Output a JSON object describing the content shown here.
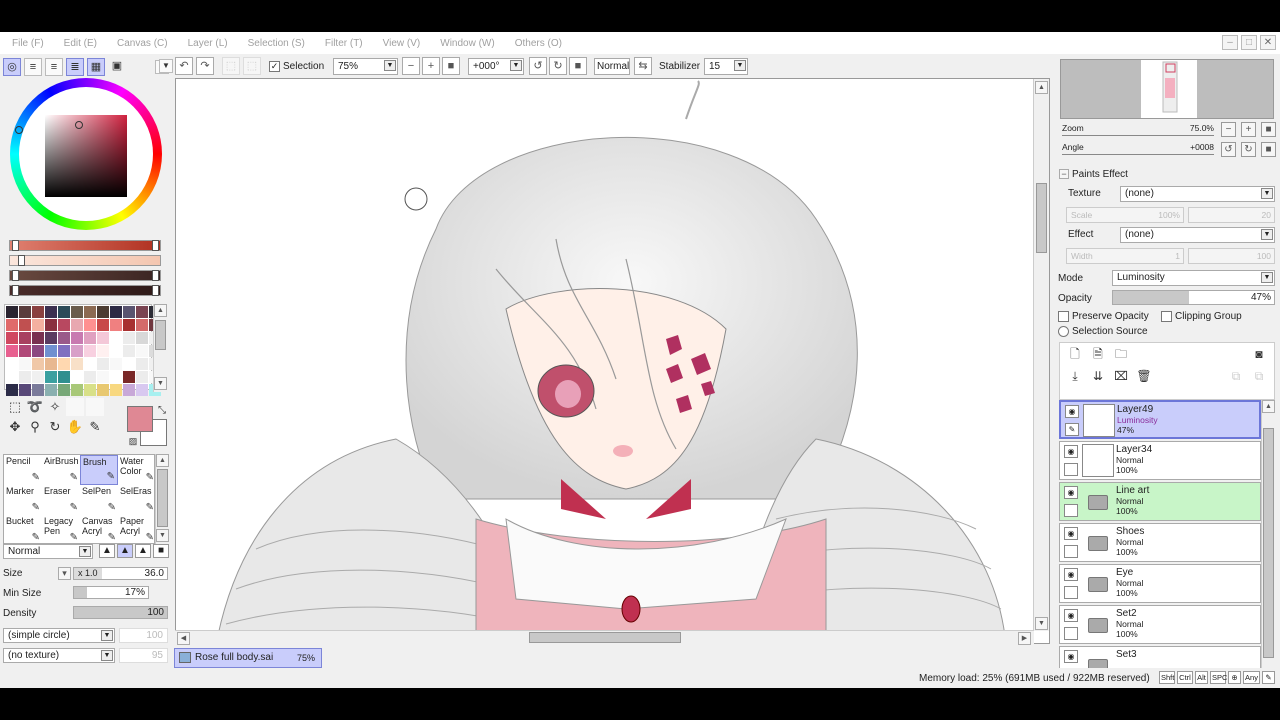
{
  "menu": [
    "File (F)",
    "Edit (E)",
    "Canvas (C)",
    "Layer (L)",
    "Selection (S)",
    "Filter (T)",
    "View (V)",
    "Window (W)",
    "Others (O)"
  ],
  "toolbar": {
    "selection_label": "Selection",
    "zoom": "75%",
    "angle": "+000°",
    "blend": "Normal",
    "stabilizer_label": "Stabilizer",
    "stabilizer_value": "15"
  },
  "color": {
    "primary": "#df8894",
    "secondary": "#ffffff"
  },
  "swatches": [
    "#2a2430",
    "#5a3c3c",
    "#8a4040",
    "#3c3050",
    "#2c4a58",
    "#6a5c4c",
    "#8c6a52",
    "#4c3c32",
    "#2e2a44",
    "#5a5470",
    "#7a4452",
    "#2c2c36",
    "#e06a6a",
    "#c05050",
    "#f4b0a0",
    "#8a3040",
    "#b84860",
    "#e8a8b0",
    "#ff9090",
    "#c84848",
    "#f08080",
    "#a83030",
    "#d46a6a",
    "#703840",
    "#d04860",
    "#a84060",
    "#7a3050",
    "#5a3a60",
    "#9a5a8a",
    "#c87ab0",
    "#e0a0c0",
    "#f4c8d8",
    "#ffffff",
    "#ececec",
    "#d8d8d8",
    "#f0f0f0",
    "#e86090",
    "#b04878",
    "#8c4880",
    "#7090d0",
    "#8070c0",
    "#d8a0c8",
    "#f8d0e0",
    "#fff0f0",
    "#ffffff",
    "#ececec",
    "#f8f8f8",
    "#dcdcdc",
    "#ffffff",
    "#f8f8f8",
    "#f0c8a8",
    "#e8b890",
    "#ffd8b0",
    "#f8e0c8",
    "#ffffff",
    "#ececec",
    "#f8f8f8",
    "#ffffff",
    "#ececec",
    "#f0f0f0",
    "#ffffff",
    "#ececec",
    "#f0f0f0",
    "#3aa0a0",
    "#2f8f8f",
    "#ffffff",
    "#ececec",
    "#f8f8f8",
    "#ffffff",
    "#7a2828",
    "#ececec",
    "#f8f8f8",
    "#2c2c48",
    "#584878",
    "#7a7a9a",
    "#8ab0b0",
    "#78a878",
    "#a8c878",
    "#d8e088",
    "#e8c870",
    "#f8d880",
    "#c8a8d8",
    "#d8c8f0",
    "#a8f0f0"
  ],
  "tools": {
    "brushes": [
      {
        "name": "Pencil",
        "line2": ""
      },
      {
        "name": "AirBrush",
        "line2": ""
      },
      {
        "name": "Brush",
        "line2": ""
      },
      {
        "name": "Water",
        "line2": "Color"
      },
      {
        "name": "Marker",
        "line2": ""
      },
      {
        "name": "Eraser",
        "line2": ""
      },
      {
        "name": "SelPen",
        "line2": ""
      },
      {
        "name": "SelEras",
        "line2": ""
      },
      {
        "name": "Bucket",
        "line2": ""
      },
      {
        "name": "Legacy",
        "line2": "Pen"
      },
      {
        "name": "Canvas",
        "line2": "Acryl"
      },
      {
        "name": "Paper",
        "line2": "Acryl"
      }
    ],
    "blend_mode": "Normal",
    "size_label": "Size",
    "size_mult": "x 1.0",
    "size_value": "36.0",
    "min_size_label": "Min Size",
    "min_size_value": "17%",
    "min_size_fraction": 0.17,
    "density_label": "Density",
    "density_value": "100",
    "density_fraction": 1.0,
    "shape": "(simple circle)",
    "shape_value": "100",
    "texture": "(no texture)",
    "texture_value": "95"
  },
  "navigator": {
    "zoom_label": "Zoom",
    "zoom_value": "75.0%",
    "angle_label": "Angle",
    "angle_value": "+0008"
  },
  "paints_effect": {
    "title": "Paints Effect",
    "texture_label": "Texture",
    "texture_value": "(none)",
    "scale_label": "Scale",
    "scale_value": "100%",
    "scale_num": "20",
    "effect_label": "Effect",
    "effect_value": "(none)",
    "width_label": "Width",
    "width_value": "1",
    "width_num": "100"
  },
  "layer_props": {
    "mode_label": "Mode",
    "mode_value": "Luminosity",
    "opacity_label": "Opacity",
    "opacity_value": "47%",
    "opacity_fraction": 0.47,
    "preserve_opacity": "Preserve Opacity",
    "clipping_group": "Clipping Group",
    "selection_source": "Selection Source"
  },
  "layers": [
    {
      "name": "Layer49",
      "mode": "Luminosity",
      "opacity": "47%",
      "type": "layer",
      "state": "selected"
    },
    {
      "name": "Layer34",
      "mode": "Normal",
      "opacity": "100%",
      "type": "layer",
      "state": "normal"
    },
    {
      "name": "Line art",
      "mode": "Normal",
      "opacity": "100%",
      "type": "folder",
      "state": "green"
    },
    {
      "name": "Shoes",
      "mode": "Normal",
      "opacity": "100%",
      "type": "folder",
      "state": "normal"
    },
    {
      "name": "Eye",
      "mode": "Normal",
      "opacity": "100%",
      "type": "folder",
      "state": "normal"
    },
    {
      "name": "Set2",
      "mode": "Normal",
      "opacity": "100%",
      "type": "folder",
      "state": "normal"
    },
    {
      "name": "Set3",
      "mode": "",
      "opacity": "",
      "type": "folder",
      "state": "normal"
    }
  ],
  "document": {
    "name": "Rose full body.sai",
    "zoom": "75%"
  },
  "status": {
    "memory": "Memory load: 25% (691MB used / 922MB reserved)",
    "keys": [
      "Shft",
      "Ctrl",
      "Alt",
      "SPC"
    ],
    "any": "Any"
  }
}
